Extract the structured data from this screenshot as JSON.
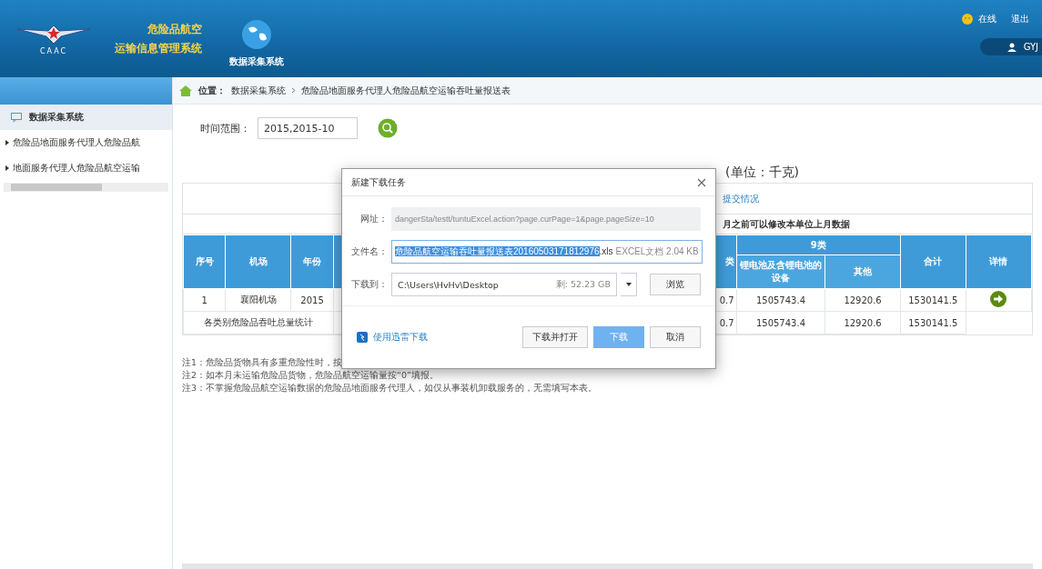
{
  "header": {
    "logo_text": "CAAC",
    "system_title": [
      "危险品航空",
      "运输信息管理系统"
    ],
    "module": "数据采集系统",
    "status": "在线",
    "logout": "退出",
    "user": "GYJ"
  },
  "breadcrumb": {
    "label": "位置：",
    "items": [
      "数据采集系统",
      "危险品地面服务代理人危险品航空运输吞吐量报送表"
    ]
  },
  "sidebar": {
    "title": "数据采集系统",
    "items": [
      {
        "label": "危险品地面服务代理人危险品航",
        "selected": false
      },
      {
        "label": "地面服务代理人危险品航空运输",
        "selected": false
      }
    ]
  },
  "filter": {
    "label": "时间范围：",
    "value": "2015,2015-10"
  },
  "report": {
    "title_fragment": "(单位：千克)",
    "link": "提交情况",
    "notice": "月之前可以修改本单位上月数据"
  },
  "table": {
    "columns": [
      "序号",
      "机场",
      "年份",
      "",
      "类"
    ],
    "group": {
      "label": "9类",
      "columns": [
        "锂电池及含锂电池的设备",
        "其他"
      ]
    },
    "tail_columns": [
      "合计",
      "详情"
    ],
    "rows": [
      {
        "kind": "data",
        "cells": [
          "1",
          "襄阳机场",
          "2015",
          "",
          "0.7",
          "1505743.4",
          "12920.6",
          "1530141.5"
        ]
      },
      {
        "kind": "total",
        "cells": [
          {
            "text": "各类别危险品吞吐总量统计",
            "colspan": 3
          },
          "",
          "0.7",
          "1505743.4",
          "12920.6",
          "1530141.5"
        ]
      }
    ]
  },
  "notes": [
    "注1：危险品货物具有多重危险性时，按",
    "注2：如本月未运输危险品货物，危险品航空运输量按“0”填报。",
    "注3：不掌握危险品航空运输数据的危险品地面服务代理人，如仅从事装机卸载服务的，无需填写本表。"
  ],
  "dialog": {
    "title": "新建下载任务",
    "url_label": "网址：",
    "url": "dangerSta/testt/tuntuExcel.action?page.curPage=1&page.pageSize=10",
    "filename_label": "文件名：",
    "filename_selected": "危险品航空运输吞吐量报送表20160503171812976",
    "filename_ext": ".xls",
    "file_info": "EXCEL文档 2.04 KB",
    "save_label": "下载到：",
    "path": "C:\\Users\\HvHv\\Desktop",
    "free": "剩: 52.23 GB",
    "browse": "浏览",
    "thunder": "使用迅雷下载",
    "buttons": [
      {
        "label": "下载并打开",
        "kind": "default"
      },
      {
        "label": "下载",
        "kind": "primary"
      },
      {
        "label": "取消",
        "kind": "default"
      }
    ]
  }
}
